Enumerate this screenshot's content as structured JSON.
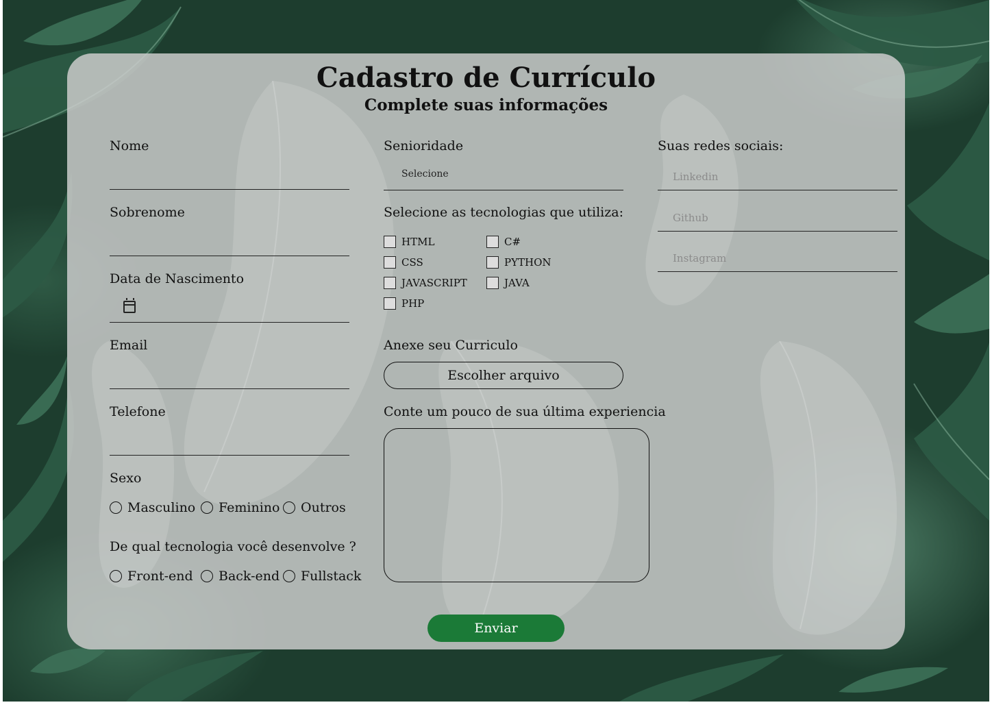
{
  "header": {
    "title": "Cadastro de Currículo",
    "subtitle": "Complete suas informações"
  },
  "personal": {
    "nome_label": "Nome",
    "sobrenome_label": "Sobrenome",
    "nascimento_label": "Data de Nascimento",
    "email_label": "Email",
    "telefone_label": "Telefone",
    "sexo_label": "Sexo",
    "sexo_options": [
      "Masculino",
      "Feminino",
      "Outros"
    ],
    "tech_area_label": "De qual tecnologia você desenvolve ?",
    "tech_area_options": [
      "Front-end",
      "Back-end",
      "Fullstack"
    ]
  },
  "professional": {
    "senioridade_label": "Senioridade",
    "senioridade_value": "Selecione",
    "tecnologias_label": "Selecione as tecnologias que utiliza:",
    "tecnologias": [
      "HTML",
      "CSS",
      "JAVASCRIPT",
      "PHP",
      "C#",
      "PYTHON",
      "JAVA"
    ],
    "anexo_label": "Anexe seu Curriculo",
    "anexo_button": "Escolher arquivo",
    "experiencia_label": "Conte um pouco de sua última experiencia"
  },
  "social": {
    "label": "Suas redes sociais:",
    "linkedin_placeholder": "Linkedin",
    "github_placeholder": "Github",
    "instagram_placeholder": "Instagram"
  },
  "submit_label": "Enviar",
  "colors": {
    "background_foliage": "#1d3d2e",
    "card_overlay": "#cdcdcd",
    "submit_button": "#1b7a37",
    "text": "#111111"
  }
}
